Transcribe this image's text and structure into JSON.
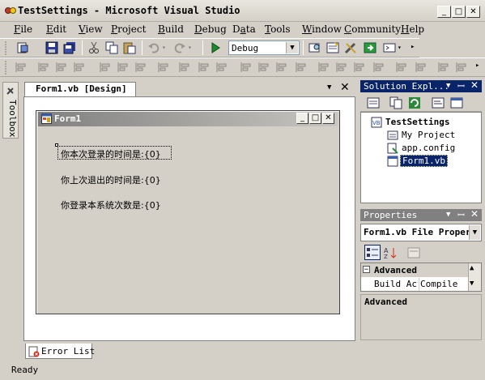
{
  "window": {
    "title": "TestSettings - Microsoft Visual Studio"
  },
  "menu": [
    {
      "pre": "",
      "u": "F",
      "post": "ile"
    },
    {
      "pre": "",
      "u": "E",
      "post": "dit"
    },
    {
      "pre": "",
      "u": "V",
      "post": "iew"
    },
    {
      "pre": "",
      "u": "P",
      "post": "roject"
    },
    {
      "pre": "",
      "u": "B",
      "post": "uild"
    },
    {
      "pre": "",
      "u": "D",
      "post": "ebug"
    },
    {
      "pre": "D",
      "u": "a",
      "post": "ta"
    },
    {
      "pre": "",
      "u": "T",
      "post": "ools"
    },
    {
      "pre": "",
      "u": "W",
      "post": "indow"
    },
    {
      "pre": "",
      "u": "C",
      "post": "ommunity"
    },
    {
      "pre": "",
      "u": "H",
      "post": "elp"
    }
  ],
  "toolbar": {
    "config": "Debug"
  },
  "toolbox": {
    "label": "Toolbox"
  },
  "document": {
    "tab": "Form1.vb [Design]",
    "form_title": "Form1",
    "labels": [
      "你本次登录的时间是:{0}",
      "你上次退出的时间是:{0}",
      "你登录本系统次数是:{0}"
    ]
  },
  "solution_explorer": {
    "title": "Solution Expl...",
    "items": [
      "TestSettings",
      "My Project",
      "app.config",
      "Form1.vb"
    ]
  },
  "properties": {
    "title": "Properties",
    "object": "Form1.vb File Proper",
    "category": "Advanced",
    "row_name": "Build Act",
    "row_value": "Compile",
    "description_title": "Advanced"
  },
  "bottom": {
    "error_tab": "Error List",
    "status": "Ready"
  },
  "colors": {
    "panel_header_active": "#0a246a",
    "panel_header_inactive": "#808080"
  }
}
